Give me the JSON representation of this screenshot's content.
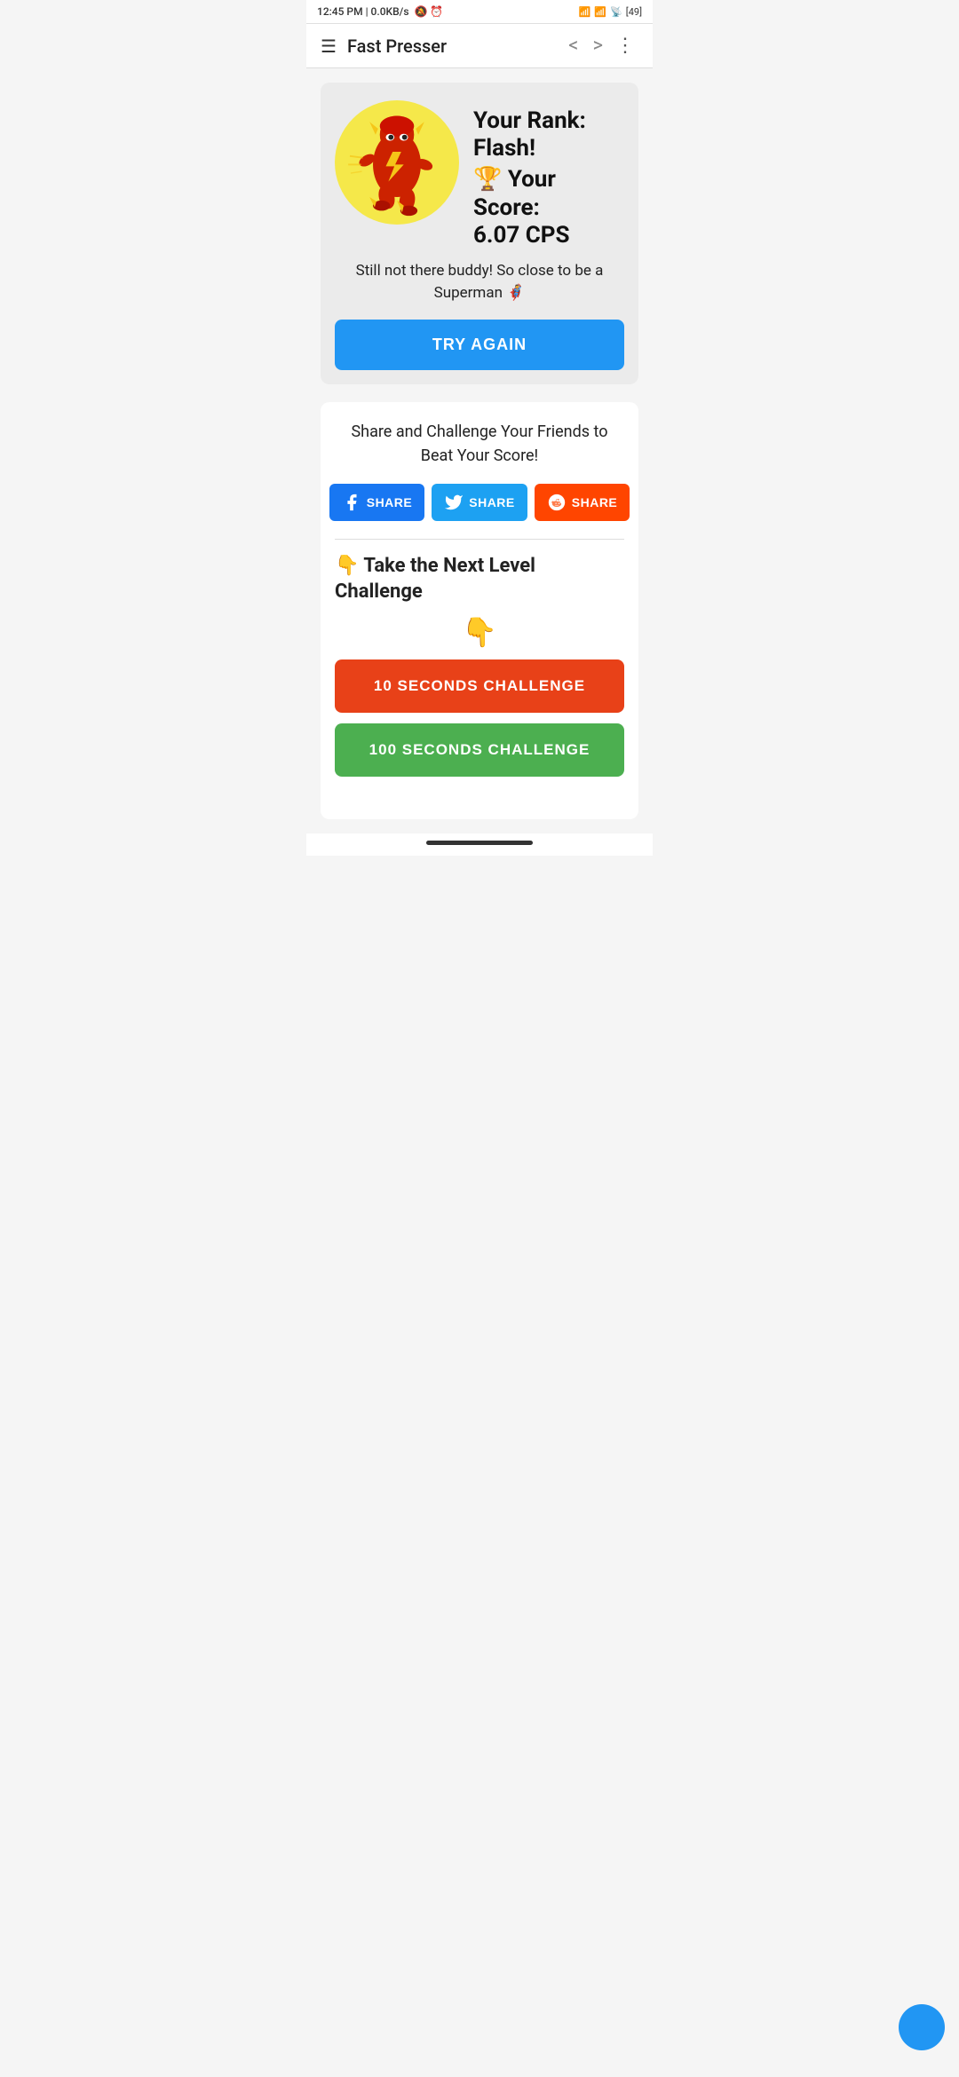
{
  "status_bar": {
    "time": "12:45 PM",
    "data": "0.0KB/s",
    "battery": "49"
  },
  "app_bar": {
    "title": "Fast Presser",
    "back_icon": "‹",
    "forward_icon": "›",
    "menu_icon": "☰",
    "more_icon": "⋮"
  },
  "result_card": {
    "rank_label": "Your Rank:",
    "rank_value": "Flash!",
    "trophy_emoji": "🏆",
    "score_label": "Your Score:",
    "score_value": "6.07",
    "score_unit": "CPS",
    "encouragement": "Still not there buddy! So close to be a Superman 🦸"
  },
  "try_again": {
    "label": "TRY AGAIN"
  },
  "share_section": {
    "text": "Share and Challenge Your Friends to Beat Your Score!",
    "facebook_label": "SHARE",
    "twitter_label": "SHARE",
    "reddit_label": "SHARE"
  },
  "next_challenge": {
    "pointer_emoji_1": "👇",
    "pointer_emoji_2": "👇",
    "title": "Take the Next Level Challenge",
    "ten_sec_label": "10 SECONDS CHALLENGE",
    "hundred_sec_label": "100 SECONDS CHALLENGE"
  },
  "colors": {
    "try_again_bg": "#2196f3",
    "facebook_bg": "#1877f2",
    "twitter_bg": "#1da1f2",
    "reddit_bg": "#ff4500",
    "ten_sec_bg": "#e84118",
    "hundred_sec_bg": "#4caf50",
    "fab_bg": "#2196f3"
  }
}
